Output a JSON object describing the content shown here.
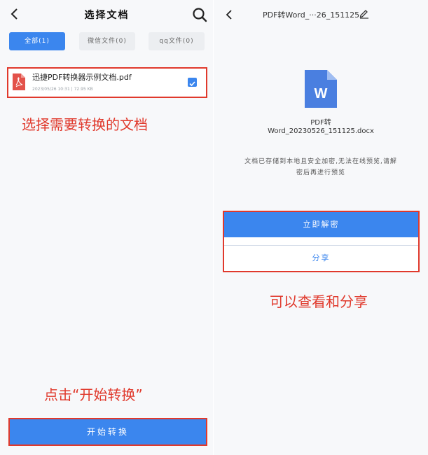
{
  "left": {
    "title": "选择文档",
    "tabs": [
      {
        "label": "全部(1)",
        "active": true
      },
      {
        "label": "微信文件(0)",
        "active": false
      },
      {
        "label": "qq文件(0)",
        "active": false
      }
    ],
    "file": {
      "name": "迅捷PDF转换器示例文档.pdf",
      "meta": "2023/05/26  10:31  |  72.95 KB",
      "checked": true
    },
    "annotation_select": "选择需要转换的文档",
    "annotation_click": "点击“开始转换”",
    "start_button": "开始转换"
  },
  "right": {
    "title": "PDF转Word_···26_151125",
    "doc_name_line1": "PDF转",
    "doc_name_line2": "Word_20230526_151125.docx",
    "word_icon_letter": "W",
    "notice_line1": "文档已存储到本地且安全加密,无法在线预览,请解",
    "notice_line2": "密后再进行预览",
    "decrypt_button": "立即解密",
    "share_button": "分享",
    "annotation": "可以查看和分享"
  },
  "colors": {
    "accent": "#3b86ee",
    "annotation_red": "#e0392c",
    "pdf_red": "#e3524a",
    "word_blue": "#4a7fe0"
  }
}
